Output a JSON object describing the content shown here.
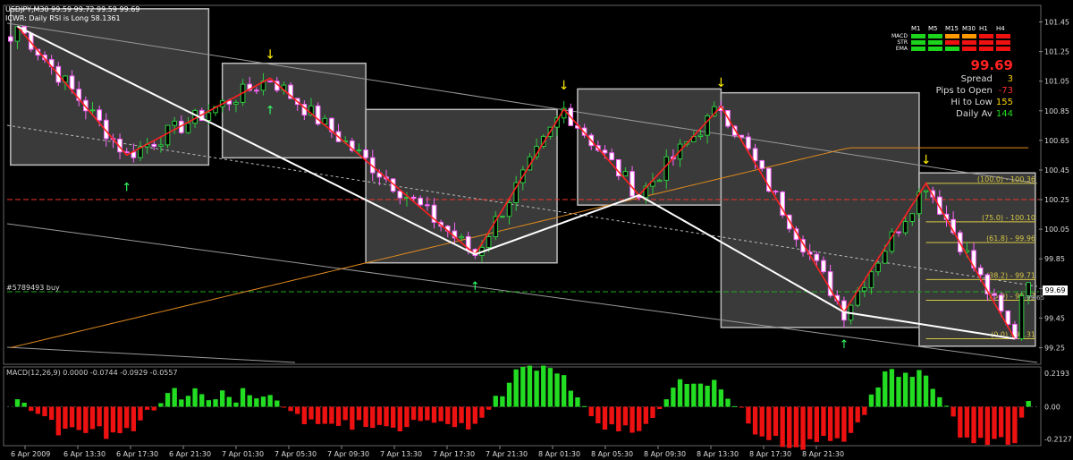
{
  "header": {
    "symbol_line": "USDJPY,M30  99.59 99.72 99.59 99.69",
    "indicator_line": "ICWR: Daily RSI is Long 58.1361"
  },
  "trade_label": "#5789493 buy",
  "price_badge": "99.69",
  "price_badge_sub": "99.65",
  "colors": {
    "background": "#000000",
    "bull_candle": "#2ecc40",
    "bear_candle": "#ff66ff",
    "wave": "#ff2020",
    "white_line": "#ffffff",
    "ma": "#e08a1e",
    "fib": "#d8c845",
    "macd_up": "#22dd22",
    "macd_down": "#ee1111"
  },
  "dashboard": {
    "timeframes": [
      "M1",
      "M5",
      "M15",
      "M30",
      "H1",
      "H4"
    ],
    "rows": [
      {
        "label": "MACD",
        "cells": [
          "green",
          "green",
          "orange",
          "orange",
          "red",
          "red"
        ]
      },
      {
        "label": "STR",
        "cells": [
          "green",
          "green",
          "red",
          "red",
          "red",
          "red"
        ]
      },
      {
        "label": "EMA",
        "cells": [
          "green",
          "green",
          "green",
          "red",
          "red",
          "red"
        ]
      }
    ],
    "price": "99.69",
    "stats": [
      {
        "label": "Spread",
        "value": "3",
        "color": "#ffd700"
      },
      {
        "label": "Pips to Open",
        "value": "-73",
        "color": "#ff3030"
      },
      {
        "label": "Hi to Low",
        "value": "155",
        "color": "#ffd700"
      },
      {
        "label": "Daily Av",
        "value": "144",
        "color": "#22dd22"
      }
    ]
  },
  "chart_data": [
    {
      "type": "candlestick",
      "title": "USDJPY,M30",
      "y_ticks": [
        "101.45",
        "101.25",
        "101.05",
        "100.85",
        "100.65",
        "100.45",
        "100.25",
        "100.05",
        "99.85",
        "99.65",
        "99.45",
        "99.25"
      ],
      "ylim": [
        99.15,
        101.55
      ],
      "x_ticks": [
        "6 Apr 2009",
        "6 Apr 13:30",
        "6 Apr 17:30",
        "6 Apr 21:30",
        "7 Apr 01:30",
        "7 Apr 05:30",
        "7 Apr 09:30",
        "7 Apr 13:30",
        "7 Apr 17:30",
        "7 Apr 21:30",
        "8 Apr 01:30",
        "8 Apr 05:30",
        "8 Apr 09:30",
        "8 Apr 13:30",
        "8 Apr 17:30",
        "8 Apr 21:30"
      ],
      "last_price": 99.69,
      "fib_levels": [
        {
          "label": "(100.0) - 100.36",
          "value": 100.36
        },
        {
          "label": "(75.0) - 100.10",
          "value": 100.1
        },
        {
          "label": "(61.8) - 99.96",
          "value": 99.96
        },
        {
          "label": "(38.2) - 99.71",
          "value": 99.71
        },
        {
          "label": "(25.0) - 99.57",
          "value": 99.57
        },
        {
          "label": "(0.0) - 99.31",
          "value": 99.31
        }
      ],
      "zigzag": [
        {
          "bar": 1,
          "value": 101.42
        },
        {
          "bar": 17,
          "value": 100.55
        },
        {
          "bar": 38,
          "value": 101.07
        },
        {
          "bar": 68,
          "value": 99.88
        },
        {
          "bar": 81,
          "value": 100.86
        },
        {
          "bar": 92,
          "value": 100.28
        },
        {
          "bar": 104,
          "value": 100.88
        },
        {
          "bar": 122,
          "value": 99.49
        },
        {
          "bar": 134,
          "value": 100.36
        },
        {
          "bar": 147,
          "value": 99.31
        }
      ]
    },
    {
      "type": "bar",
      "title": "MACD(12,26,9)",
      "header": "MACD(12,26,9) 0.0000 -0.0744 -0.0929 -0.0557",
      "y_ticks": [
        "0.2193",
        "0.00",
        "-0.2127"
      ],
      "ylim": [
        -0.25,
        0.25
      ]
    }
  ]
}
